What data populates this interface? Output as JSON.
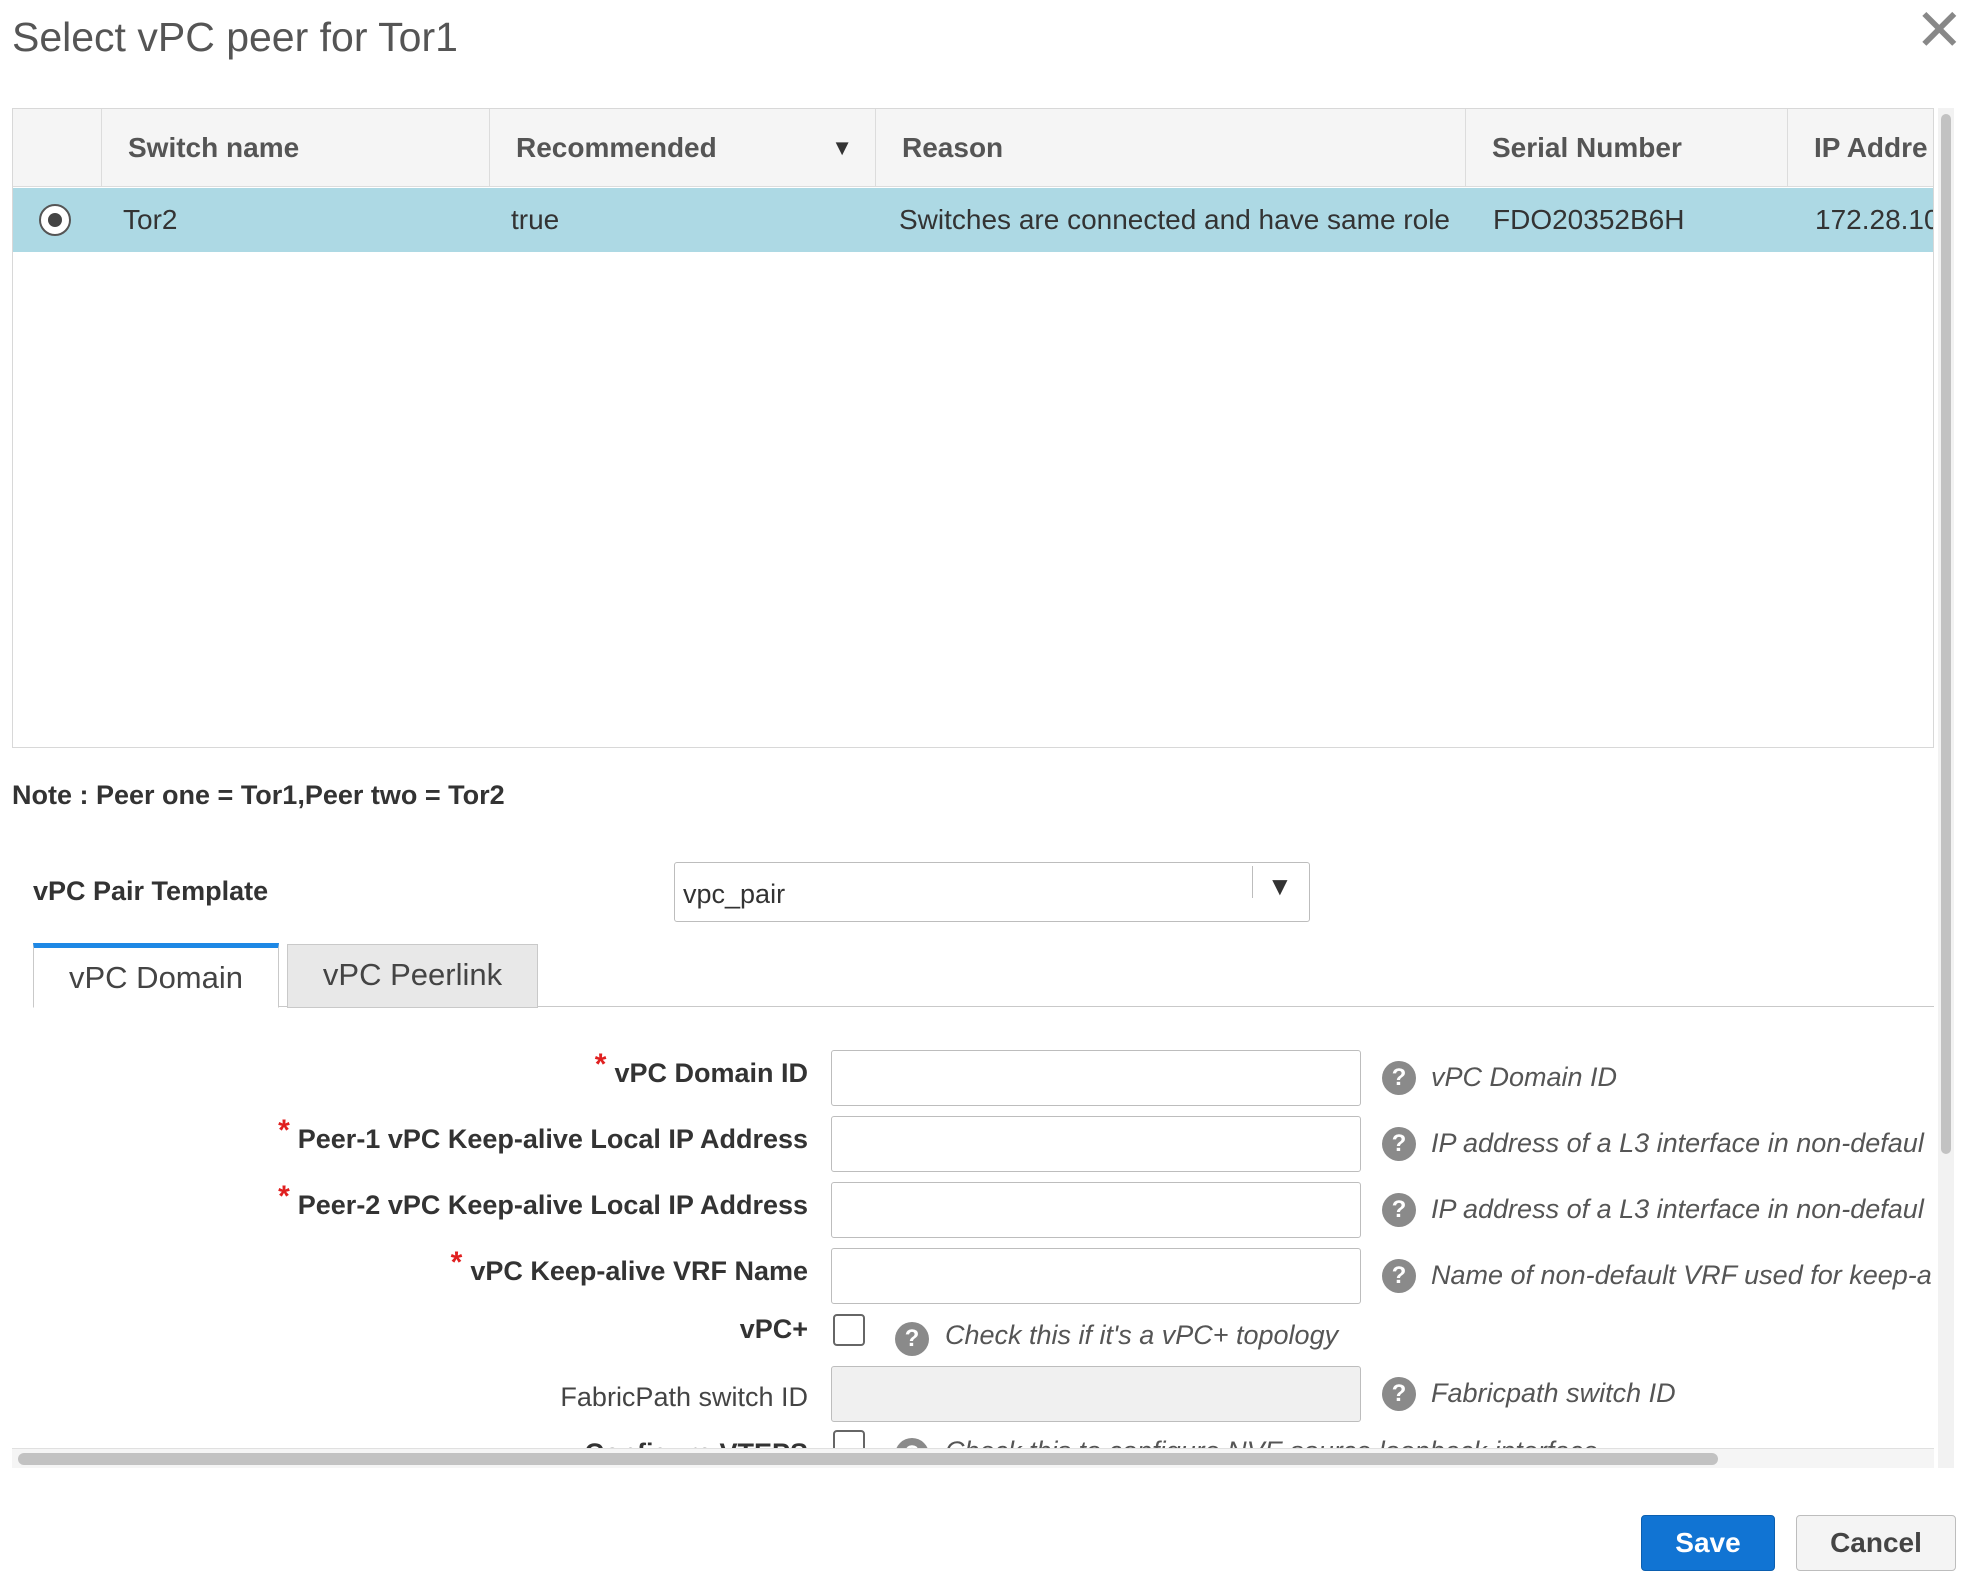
{
  "dialog": {
    "title": "Select vPC peer for Tor1",
    "close_icon": "close-icon"
  },
  "table": {
    "columns": [
      "Switch name",
      "Recommended",
      "Reason",
      "Serial Number",
      "IP Addre"
    ],
    "sort_icon": "sort-desc-icon",
    "rows": [
      {
        "selected": true,
        "switch_name": "Tor2",
        "recommended": "true",
        "reason": "Switches are connected and have same role",
        "serial_number": "FDO20352B6H",
        "ip_address": "172.28.10"
      }
    ]
  },
  "note": "Note : Peer one = Tor1,Peer two = Tor2",
  "template": {
    "label": "vPC Pair Template",
    "value": "vpc_pair",
    "arrow_icon": "dropdown-arrow-icon"
  },
  "tabs": [
    {
      "label": "vPC Domain",
      "active": true
    },
    {
      "label": "vPC Peerlink",
      "active": false
    }
  ],
  "form": {
    "required_mark": "*",
    "help_icon_glyph": "?",
    "fields": [
      {
        "label": "vPC Domain ID",
        "required": true,
        "value": "",
        "help": "vPC Domain ID"
      },
      {
        "label": "Peer-1 vPC Keep-alive Local IP Address",
        "required": true,
        "value": "",
        "help": "IP address of a L3 interface in non-defaul"
      },
      {
        "label": "Peer-2 vPC Keep-alive Local IP Address",
        "required": true,
        "value": "",
        "help": "IP address of a L3 interface in non-defaul"
      },
      {
        "label": "vPC Keep-alive VRF Name",
        "required": true,
        "value": "",
        "help": "Name of non-default VRF used for keep-a"
      },
      {
        "label": "vPC+",
        "type": "checkbox",
        "checked": false,
        "help": "Check this if it's a vPC+ topology"
      },
      {
        "label": "FabricPath switch ID",
        "required": false,
        "disabled": true,
        "value": "",
        "help": "Fabricpath switch ID"
      },
      {
        "label": "Configure VTEPS",
        "type": "checkbox",
        "checked": false,
        "help": "Check this to configure NVE source loopback interface"
      }
    ]
  },
  "buttons": {
    "save": "Save",
    "cancel": "Cancel"
  }
}
